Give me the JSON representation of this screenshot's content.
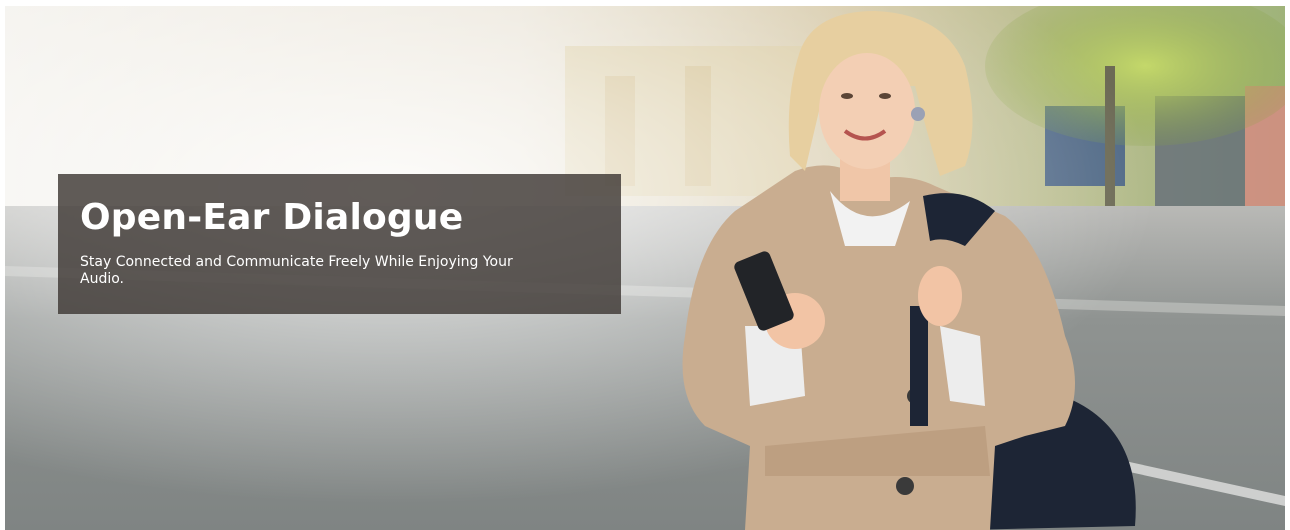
{
  "banner": {
    "title": "Open-Ear Dialogue",
    "subtitle": "Stay Connected and Communicate Freely While Enjoying Your Audio.",
    "image_subject": "woman-with-earbud-holding-phone",
    "colors": {
      "overlay": "#3e3834",
      "text": "#ffffff",
      "coat": "#c9ad90",
      "backpack": "#1d2535",
      "hair": "#e7cfa0",
      "foliage": "#a9c650"
    }
  }
}
